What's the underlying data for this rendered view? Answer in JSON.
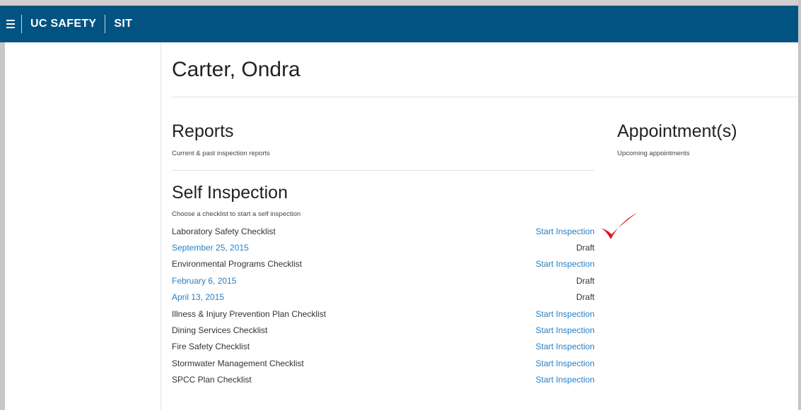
{
  "header": {
    "brand": "UC SAFETY",
    "env": "SIT",
    "bg_color": "#035382"
  },
  "page": {
    "title": "Carter, Ondra"
  },
  "reports": {
    "title": "Reports",
    "subtitle": "Current & past inspection reports"
  },
  "appointments": {
    "title": "Appointment(s)",
    "subtitle": "Upcoming appointments"
  },
  "self_inspection": {
    "title": "Self Inspection",
    "subtitle": "Choose a checklist to start a self inspection",
    "rows": [
      {
        "label": "Laboratory Safety Checklist",
        "action": "Start Inspection"
      },
      {
        "label": "September 25, 2015",
        "status": "Draft"
      },
      {
        "label": "Environmental Programs Checklist",
        "action": "Start Inspection"
      },
      {
        "label": "February 6, 2015",
        "status": "Draft"
      },
      {
        "label": "April 13, 2015",
        "status": "Draft"
      },
      {
        "label": "Illness & Injury Prevention Plan Checklist",
        "action": "Start Inspection"
      },
      {
        "label": "Dining Services Checklist",
        "action": "Start Inspection"
      },
      {
        "label": "Fire Safety Checklist",
        "action": "Start Inspection"
      },
      {
        "label": "Stormwater Management Checklist",
        "action": "Start Inspection"
      },
      {
        "label": "SPCC Plan Checklist",
        "action": "Start Inspection"
      }
    ]
  },
  "icons": {
    "menu": "hamburger-menu-icon",
    "annotation": "red-checkmark-icon"
  },
  "colors": {
    "link": "#2a7fc1",
    "check": "#e0101a"
  }
}
